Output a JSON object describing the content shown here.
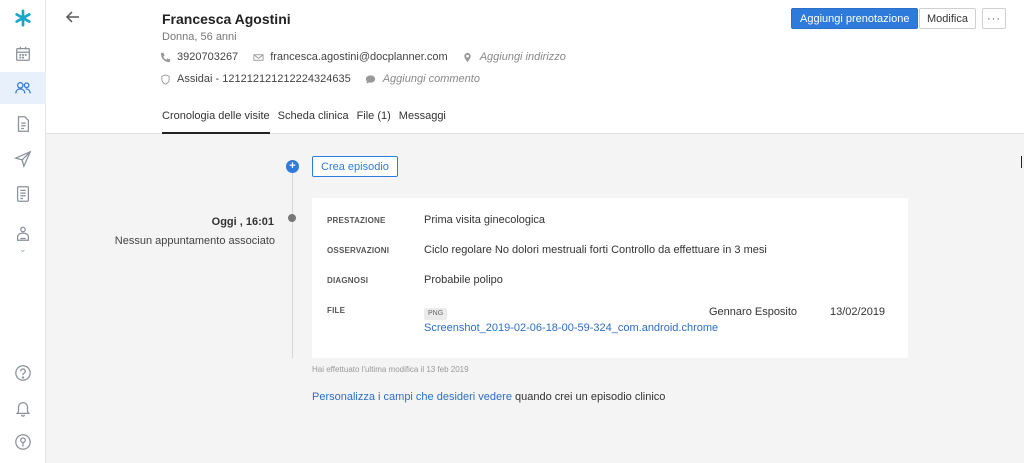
{
  "patient": {
    "name": "Francesca Agostini",
    "subtitle": "Donna, 56 anni",
    "phone": "3920703267",
    "email": "francesca.agostini@docplanner.com",
    "address_placeholder": "Aggiungi indirizzo",
    "insurance": "Assidai - 121212121212224324635",
    "comment_placeholder": "Aggiungi commento"
  },
  "header": {
    "book_button": "Aggiungi prenotazione",
    "edit_button": "Modifica",
    "more_button": "···"
  },
  "tabs": [
    {
      "label": "Cronologia delle visite"
    },
    {
      "label": "Scheda clinica"
    },
    {
      "label": "File (1)"
    },
    {
      "label": "Messaggi"
    }
  ],
  "timeline": {
    "create_episode": "Crea episodio",
    "plus": "+",
    "visit_time": "Oggi , 16:01",
    "visit_note": "Nessun appuntamento associato"
  },
  "episode": {
    "prestazione_label": "PRESTAZIONE",
    "prestazione_value": "Prima visita ginecologica",
    "osservazioni_label": "OSSERVAZIONI",
    "osservazioni_value": "Ciclo regolare No dolori mestruali forti Controllo da effettuare in 3 mesi",
    "diagnosi_label": "DIAGNOSI",
    "diagnosi_value": "Probabile polipo",
    "file_label": "FILE",
    "file_type": "PNG",
    "file_name": "Screenshot_2019-02-06-18-00-59-324_com.android.chrome",
    "file_author": "Gennaro Esposito",
    "file_date": "13/02/2019"
  },
  "footer": {
    "last_modified": "Hai effettuato l'ultima modifica il 13 feb 2019",
    "customize_link": "Personalizza i campi che desideri vedere",
    "customize_suffix": " quando crei un episodio clinico"
  },
  "colors": {
    "accent": "#2e7bdb",
    "link": "#2e6ec4",
    "background": "#f4f4f4"
  },
  "icons": [
    "logo-icon",
    "calendar-icon",
    "patients-icon",
    "document-icon",
    "send-icon",
    "report-icon",
    "integrations-icon",
    "help-icon",
    "bell-icon",
    "account-icon",
    "back-arrow-icon",
    "phone-icon",
    "email-icon",
    "location-icon",
    "shield-icon",
    "comment-icon"
  ]
}
